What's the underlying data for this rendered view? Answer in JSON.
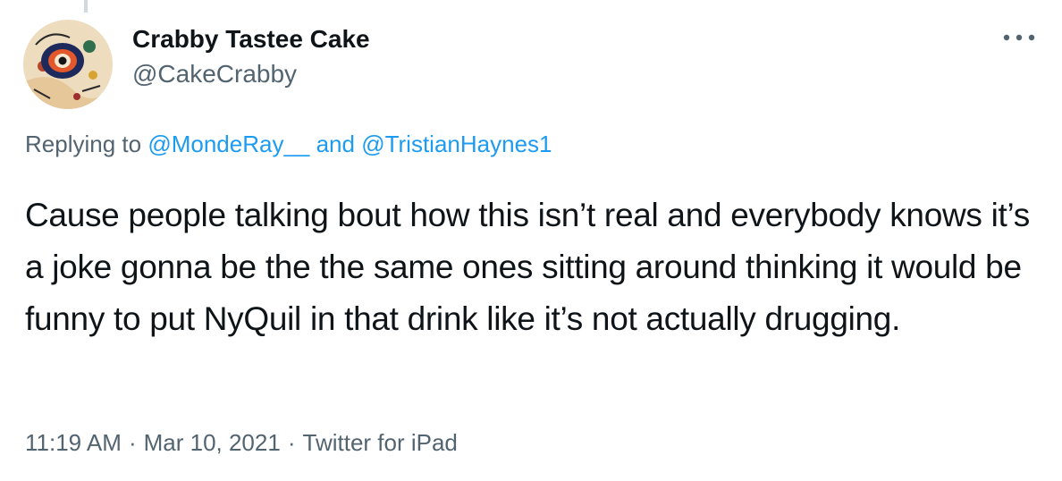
{
  "tweet": {
    "display_name": "Crabby Tastee Cake",
    "handle": "@CakeCrabby",
    "more_icon": "more-dots-icon",
    "replying_prefix": "Replying to ",
    "mentions": [
      "@MondeRay__",
      "@TristianHaynes1"
    ],
    "mention_join": " and ",
    "text": "Cause people talking bout how this isn’t real and everybody knows it’s a joke gonna be the the same ones sitting around thinking it would be funny to put NyQuil in that drink like it’s not actually drugging.",
    "time": "11:19 AM",
    "date": "Mar 10, 2021",
    "source": "Twitter for iPad",
    "separator": "·"
  },
  "colors": {
    "text_primary": "#0f1419",
    "text_secondary": "#536471",
    "link": "#1d9bf0"
  }
}
